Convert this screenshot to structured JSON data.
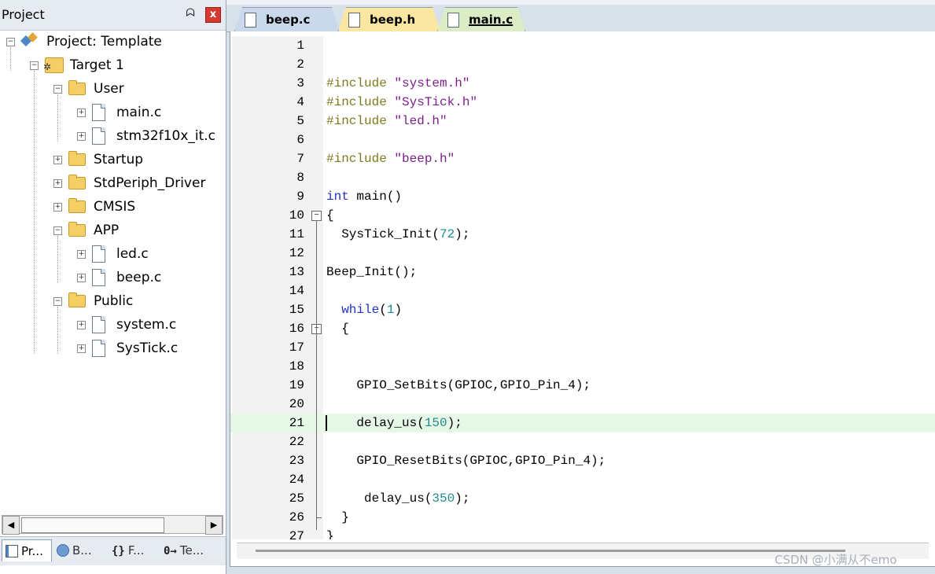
{
  "project_panel": {
    "title": "Project",
    "pin_symbol": "ᗣ",
    "close_symbol": "x",
    "tree": [
      {
        "label": "Project: Template",
        "icon": "project-icon",
        "level": 0,
        "expander": "−"
      },
      {
        "label": "Target 1",
        "icon": "target-icon",
        "level": 1,
        "expander": "−"
      },
      {
        "label": "User",
        "icon": "folder-open-icon",
        "level": 2,
        "expander": "−"
      },
      {
        "label": "main.c",
        "icon": "file-icon",
        "level": 3,
        "expander": "+"
      },
      {
        "label": "stm32f10x_it.c",
        "icon": "file-icon",
        "level": 3,
        "expander": "+"
      },
      {
        "label": "Startup",
        "icon": "folder-icon",
        "level": 2,
        "expander": "+"
      },
      {
        "label": "StdPeriph_Driver",
        "icon": "folder-icon",
        "level": 2,
        "expander": "+"
      },
      {
        "label": "CMSIS",
        "icon": "folder-icon",
        "level": 2,
        "expander": "+"
      },
      {
        "label": "APP",
        "icon": "folder-open-icon",
        "level": 2,
        "expander": "−"
      },
      {
        "label": "led.c",
        "icon": "file-icon",
        "level": 3,
        "expander": "+"
      },
      {
        "label": "beep.c",
        "icon": "file-icon",
        "level": 3,
        "expander": "+"
      },
      {
        "label": "Public",
        "icon": "folder-open-icon",
        "level": 2,
        "expander": "−"
      },
      {
        "label": "system.c",
        "icon": "file-icon",
        "level": 3,
        "expander": "+"
      },
      {
        "label": "SysTick.c",
        "icon": "file-icon",
        "level": 3,
        "expander": "+"
      }
    ],
    "scroll_left": "◀",
    "scroll_right": "▶",
    "bottom_tabs": [
      {
        "label": "Pr...",
        "icon": "project-tab-icon",
        "active": true
      },
      {
        "label": "B...",
        "icon": "books-tab-icon",
        "active": false
      },
      {
        "label": "F...",
        "icon": "functions-tab-icon",
        "glyph": "{}",
        "active": false
      },
      {
        "label": "Te...",
        "icon": "templates-tab-icon",
        "glyph": "0→",
        "active": false
      }
    ]
  },
  "editor": {
    "tabs": [
      {
        "label": "beep.c",
        "color": "#c9d8ea"
      },
      {
        "label": "beep.h",
        "color": "#fbe6a2"
      },
      {
        "label": "main.c",
        "color": "#dcecc5",
        "active": true
      }
    ],
    "current_line": 21,
    "lines": [
      {
        "n": "1",
        "tokens": []
      },
      {
        "n": "2",
        "tokens": []
      },
      {
        "n": "3",
        "tokens": [
          [
            "pre",
            "#include "
          ],
          [
            "str",
            "\"system.h\""
          ]
        ]
      },
      {
        "n": "4",
        "tokens": [
          [
            "pre",
            "#include "
          ],
          [
            "str",
            "\"SysTick.h\""
          ]
        ]
      },
      {
        "n": "5",
        "tokens": [
          [
            "pre",
            "#include "
          ],
          [
            "str",
            "\"led.h\""
          ]
        ]
      },
      {
        "n": "6",
        "tokens": []
      },
      {
        "n": "7",
        "tokens": [
          [
            "pre",
            "#include "
          ],
          [
            "str",
            "\"beep.h\""
          ]
        ]
      },
      {
        "n": "8",
        "tokens": []
      },
      {
        "n": "9",
        "tokens": [
          [
            "kw",
            "int"
          ],
          [
            "txt",
            " main()"
          ]
        ]
      },
      {
        "n": "10",
        "tokens": [
          [
            "txt",
            "{"
          ]
        ],
        "fold": "open"
      },
      {
        "n": "11",
        "tokens": [
          [
            "txt",
            "  SysTick_Init("
          ],
          [
            "num",
            "72"
          ],
          [
            "txt",
            ");"
          ]
        ]
      },
      {
        "n": "12",
        "tokens": []
      },
      {
        "n": "13",
        "tokens": [
          [
            "txt",
            "Beep_Init();"
          ]
        ]
      },
      {
        "n": "14",
        "tokens": []
      },
      {
        "n": "15",
        "tokens": [
          [
            "kw",
            "  while"
          ],
          [
            "txt",
            "("
          ],
          [
            "num",
            "1"
          ],
          [
            "txt",
            ")"
          ]
        ]
      },
      {
        "n": "16",
        "tokens": [
          [
            "txt",
            "  {"
          ]
        ],
        "fold": "open"
      },
      {
        "n": "17",
        "tokens": []
      },
      {
        "n": "18",
        "tokens": []
      },
      {
        "n": "19",
        "tokens": [
          [
            "txt",
            "    GPIO_SetBits(GPIOC,GPIO_Pin_4);"
          ]
        ]
      },
      {
        "n": "20",
        "tokens": []
      },
      {
        "n": "21",
        "tokens": [
          [
            "txt",
            "    delay_us("
          ],
          [
            "num",
            "150"
          ],
          [
            "txt",
            ");"
          ]
        ]
      },
      {
        "n": "22",
        "tokens": []
      },
      {
        "n": "23",
        "tokens": [
          [
            "txt",
            "    GPIO_ResetBits(GPIOC,GPIO_Pin_4);"
          ]
        ]
      },
      {
        "n": "24",
        "tokens": []
      },
      {
        "n": "25",
        "tokens": [
          [
            "txt",
            "     delay_us("
          ],
          [
            "num",
            "350"
          ],
          [
            "txt",
            ");"
          ]
        ]
      },
      {
        "n": "26",
        "tokens": [
          [
            "txt",
            "  }"
          ]
        ],
        "fold": "end"
      },
      {
        "n": "27",
        "tokens": [
          [
            "txt",
            "}"
          ]
        ]
      }
    ]
  },
  "watermark": "CSDN @小满从不emo"
}
